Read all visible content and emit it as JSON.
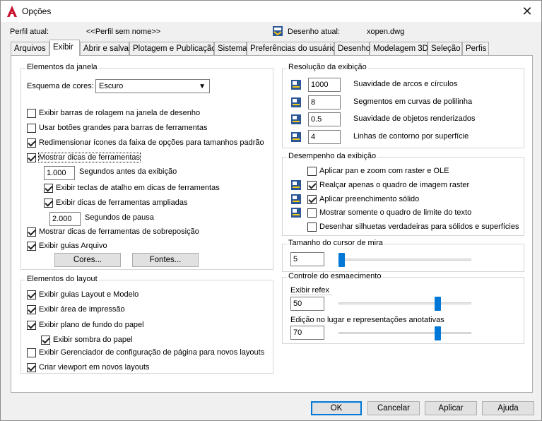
{
  "window": {
    "title": "Opções"
  },
  "header": {
    "profile_label": "Perfil atual:",
    "profile_value": "<<Perfil sem nome>>",
    "drawing_label": "Desenho atual:",
    "drawing_value": "xopen.dwg"
  },
  "tabs": [
    {
      "label": "Arquivos"
    },
    {
      "label": "Exibir"
    },
    {
      "label": "Abrir e salvar"
    },
    {
      "label": "Plotagem e Publicação"
    },
    {
      "label": "Sistema"
    },
    {
      "label": "Preferências do usuário"
    },
    {
      "label": "Desenho"
    },
    {
      "label": "Modelagem 3D"
    },
    {
      "label": "Seleção"
    },
    {
      "label": "Perfis"
    }
  ],
  "window_elements": {
    "title": "Elementos da janela",
    "color_scheme_label": "Esquema de cores:",
    "color_scheme_value": "Escuro",
    "scrollbars": "Exibir barras de rolagem na janela de desenho",
    "large_buttons": "Usar botões grandes para barras de ferramentas",
    "resize_ribbon": "Redimensionar ícones da faixa de opções para tamanhos padrão",
    "show_tooltips": "Mostrar dicas de ferramentas",
    "seconds_before_value": "1.000",
    "seconds_before_label": "Segundos antes da exibição",
    "shortcut_keys": "Exibir teclas de atalho em dicas de ferramentas",
    "extended_tooltips": "Exibir dicas de ferramentas ampliadas",
    "delay_value": "2.000",
    "delay_label": "Segundos de pausa",
    "rollover": "Mostrar dicas de ferramentas de sobreposição",
    "file_tabs": "Exibir guias Arquivo",
    "colors_btn": "Cores...",
    "fonts_btn": "Fontes..."
  },
  "layout_elements": {
    "title": "Elementos do layout",
    "layout_model_tabs": "Exibir guias Layout e Modelo",
    "printable_area": "Exibir área de impressão",
    "paper_background": "Exibir plano de fundo do papel",
    "paper_shadow": "Exibir sombra do papel",
    "page_setup_manager": "Exibir Gerenciador de configuração de página para novos layouts",
    "create_viewport": "Criar viewport em novos layouts"
  },
  "display_resolution": {
    "title": "Resolução da exibição",
    "arc_smoothness_value": "1000",
    "arc_smoothness_label": "Suavidade de arcos e círculos",
    "polyline_segments_value": "8",
    "polyline_segments_label": "Segmentos em curvas de polilinha",
    "rendered_smoothness_value": "0.5",
    "rendered_smoothness_label": "Suavidade de objetos renderizados",
    "contour_lines_value": "4",
    "contour_lines_label": "Linhas de contorno por superfície"
  },
  "display_performance": {
    "title": "Desempenho da exibição",
    "pan_zoom_raster": "Aplicar pan e zoom com raster e OLE",
    "highlight_raster_frame": "Realçar apenas o quadro de imagem raster",
    "solid_fill": "Aplicar preenchimento sólido",
    "text_boundary": "Mostrar somente o quadro de limite do texto",
    "true_silhouettes": "Desenhar silhuetas verdadeiras para sólidos e superfícies"
  },
  "crosshair": {
    "title": "Tamanho do cursor de mira",
    "value": "5",
    "slider_fraction": 0.0
  },
  "fade_control": {
    "title": "Controle do esmaecimento",
    "xref_label": "Exibir refex",
    "xref_value": "50",
    "xref_fraction": 0.76,
    "inplace_label": "Edição no lugar e representações anotativas",
    "inplace_value": "70",
    "inplace_fraction": 0.76
  },
  "footer": {
    "ok": "OK",
    "cancel": "Cancelar",
    "apply": "Aplicar",
    "help": "Ajuda"
  },
  "colors": {
    "accent": "#0078d7",
    "autocad_red": "#c8102e"
  }
}
